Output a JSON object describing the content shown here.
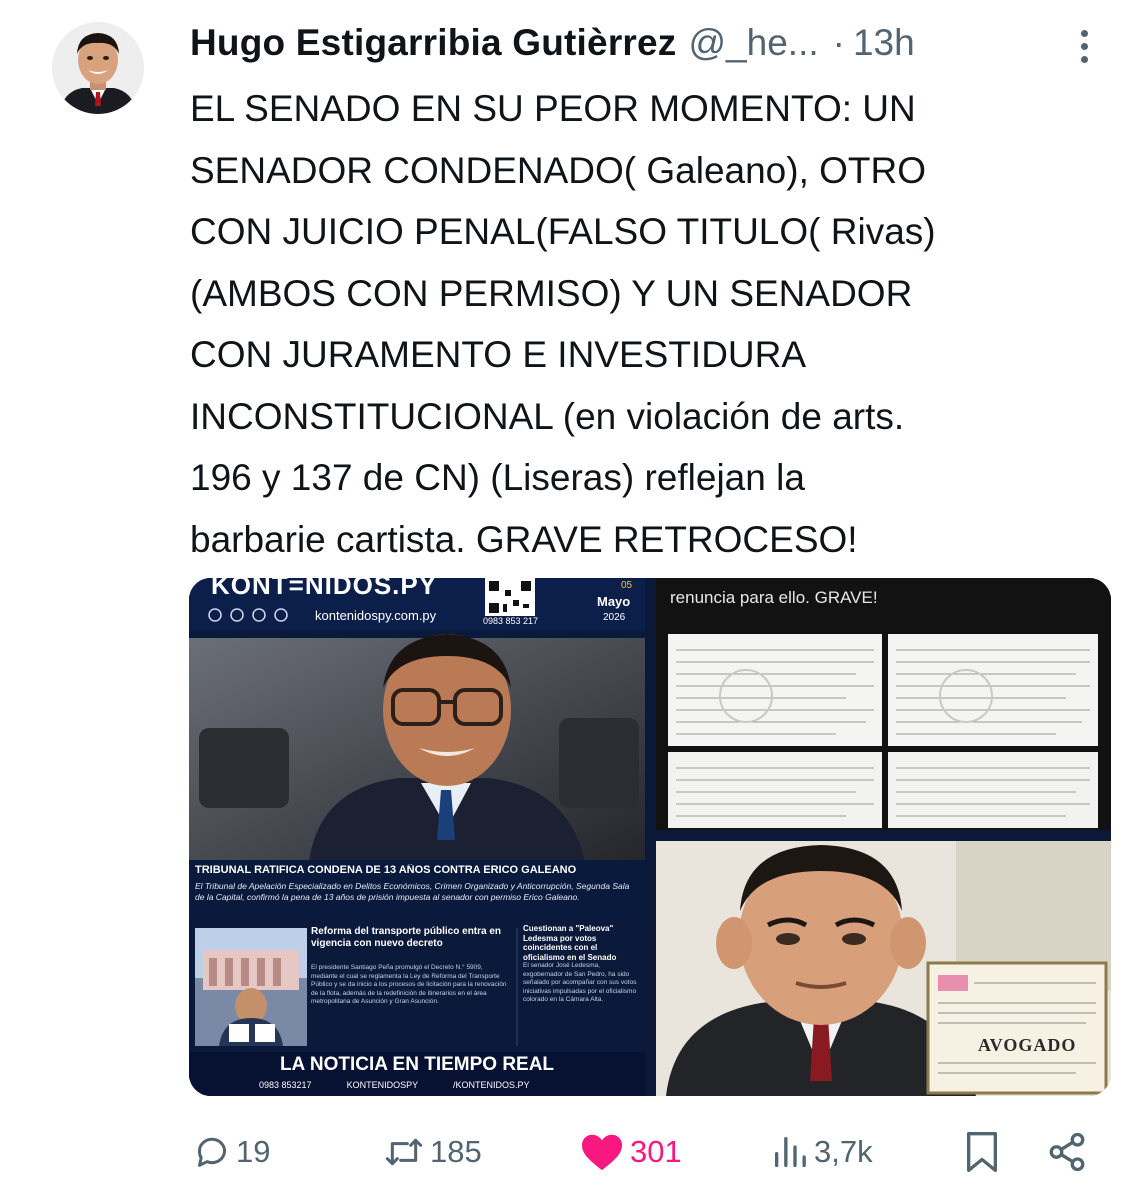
{
  "tweet": {
    "author_name": "Hugo Estigarribia Gutièrrez",
    "handle": "@_he...",
    "separator": "·",
    "time": "13h",
    "text": "EL SENADO EN SU PEOR MOMENTO: UN\nSENADOR CONDENADO( Galeano), OTRO\nCON JUICIO PENAL(FALSO TITULO( Rivas)\n(AMBOS CON PERMISO) Y  UN SENADOR\nCON JURAMENTO E INVESTIDURA\nINCONSTITUCIONAL (en violación de arts.\n196 y 137 de CN) (Liseras) reflejan la\nbarbarie cartista. GRAVE RETROCESO!"
  },
  "media": {
    "image1": {
      "brand": "KONT=NIDOS.PY",
      "website": "kontenidospy.com.py",
      "phone": "0983 853 217",
      "date_day": "05",
      "date_month": "Mayo",
      "date_year": "2026",
      "headline": "TRIBUNAL RATIFICA CONDENA DE 13 AÑOS CONTRA ERICO GALEANO",
      "lead": "El Tribunal de Apelación Especializado en Delitos Económicos, Crimen Organizado y Anticorrupción, Segunda Sala de la Capital, confirmó la pena de 13 años de prisión impuesta al senador con permiso Erico Galeano.",
      "story2_title": "Reforma del transporte público entra en vigencia con nuevo decreto",
      "story2_body": "El presidente Santiago Peña promulgó el Decreto N.° 5909, mediante el cual se reglamenta la Ley de Reforma del Transporte Público y se da inicio a los procesos de licitación para la renovación de la flota, además de la redefinición de itinerarios en el área metropolitana de Asunción y Gran Asunción.",
      "story3_title": "Cuestionan a \"Paleova\" Ledesma por votos coincidentes con el oficialismo en el Senado",
      "story3_body": "El senador José Ledesma, exgobernador de San Pedro, ha sido señalado por acompañar con sus votos iniciativas impulsadas por el oficialismo colorado en la Cámara Alta.",
      "footer_slogan": "LA NOTICIA EN TIEMPO REAL",
      "footer_phone": "0983 853217",
      "footer_x": "KONTENIDOSPY",
      "footer_ig": "/KONTENIDOS.PY"
    },
    "image2": {
      "caption": "renuncia para ello. GRAVE!"
    },
    "image3": {
      "diploma_word": "AVOGADO"
    }
  },
  "actions": {
    "replies": "19",
    "reposts": "185",
    "likes": "301",
    "views": "3,7k"
  },
  "colors": {
    "text": "#0f1419",
    "muted": "#536471",
    "like": "#f91880",
    "news_navy": "#0a1a3d"
  }
}
